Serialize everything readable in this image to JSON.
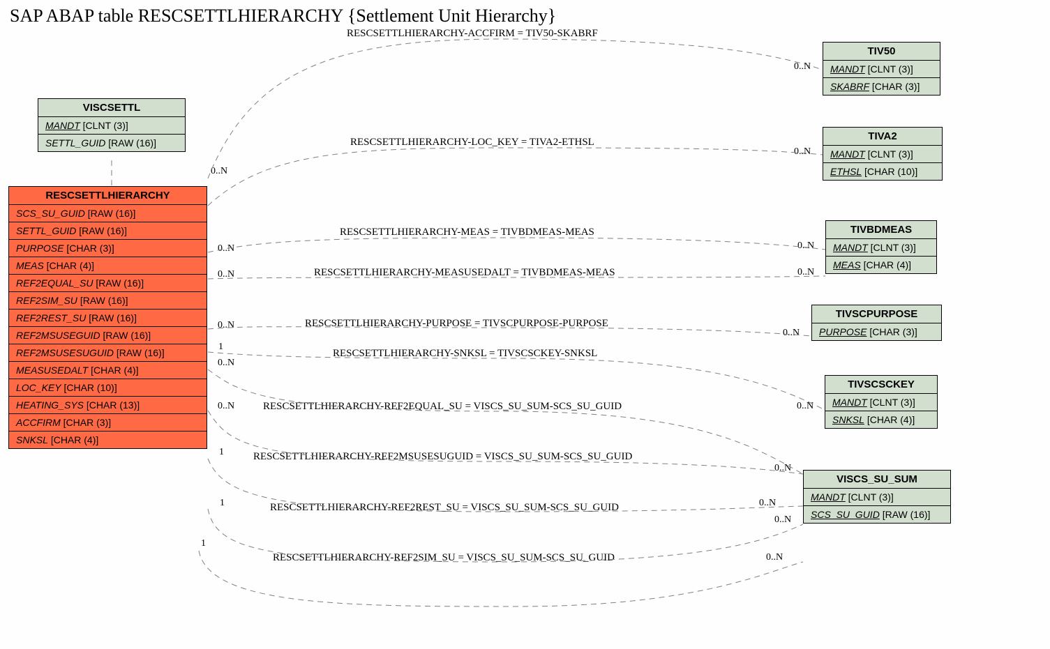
{
  "title": "SAP ABAP table RESCSETTLHIERARCHY {Settlement Unit Hierarchy}",
  "tables": {
    "viscsettl": {
      "name": "VISCSETTL",
      "rows": [
        {
          "name": "MANDT",
          "type": "[CLNT (3)]",
          "underline": true
        },
        {
          "name": "SETTL_GUID",
          "type": "[RAW (16)]",
          "underline": false
        }
      ]
    },
    "main": {
      "name": "RESCSETTLHIERARCHY",
      "rows": [
        {
          "name": "SCS_SU_GUID",
          "type": "[RAW (16)]",
          "underline": false
        },
        {
          "name": "SETTL_GUID",
          "type": "[RAW (16)]",
          "underline": false
        },
        {
          "name": "PURPOSE",
          "type": "[CHAR (3)]",
          "underline": false
        },
        {
          "name": "MEAS",
          "type": "[CHAR (4)]",
          "underline": false
        },
        {
          "name": "REF2EQUAL_SU",
          "type": "[RAW (16)]",
          "underline": false
        },
        {
          "name": "REF2SIM_SU",
          "type": "[RAW (16)]",
          "underline": false
        },
        {
          "name": "REF2REST_SU",
          "type": "[RAW (16)]",
          "underline": false
        },
        {
          "name": "REF2MSUSEGUID",
          "type": "[RAW (16)]",
          "underline": false
        },
        {
          "name": "REF2MSUSESUGUID",
          "type": "[RAW (16)]",
          "underline": false
        },
        {
          "name": "MEASUSEDALT",
          "type": "[CHAR (4)]",
          "underline": false
        },
        {
          "name": "LOC_KEY",
          "type": "[CHAR (10)]",
          "underline": false
        },
        {
          "name": "HEATING_SYS",
          "type": "[CHAR (13)]",
          "underline": false
        },
        {
          "name": "ACCFIRM",
          "type": "[CHAR (3)]",
          "underline": false
        },
        {
          "name": "SNKSL",
          "type": "[CHAR (4)]",
          "underline": false
        }
      ]
    },
    "tiv50": {
      "name": "TIV50",
      "rows": [
        {
          "name": "MANDT",
          "type": "[CLNT (3)]",
          "underline": true
        },
        {
          "name": "SKABRF",
          "type": "[CHAR (3)]",
          "underline": true
        }
      ]
    },
    "tiva2": {
      "name": "TIVA2",
      "rows": [
        {
          "name": "MANDT",
          "type": "[CLNT (3)]",
          "underline": true
        },
        {
          "name": "ETHSL",
          "type": "[CHAR (10)]",
          "underline": true
        }
      ]
    },
    "tivbdmeas": {
      "name": "TIVBDMEAS",
      "rows": [
        {
          "name": "MANDT",
          "type": "[CLNT (3)]",
          "underline": true
        },
        {
          "name": "MEAS",
          "type": "[CHAR (4)]",
          "underline": true
        }
      ]
    },
    "tivscpurpose": {
      "name": "TIVSCPURPOSE",
      "rows": [
        {
          "name": "PURPOSE",
          "type": "[CHAR (3)]",
          "underline": true
        }
      ]
    },
    "tivscsckey": {
      "name": "TIVSCSCKEY",
      "rows": [
        {
          "name": "MANDT",
          "type": "[CLNT (3)]",
          "underline": true
        },
        {
          "name": "SNKSL",
          "type": "[CHAR (4)]",
          "underline": true
        }
      ]
    },
    "viscs_su_sum": {
      "name": "VISCS_SU_SUM",
      "rows": [
        {
          "name": "MANDT",
          "type": "[CLNT (3)]",
          "underline": true
        },
        {
          "name": "SCS_SU_GUID",
          "type": "[RAW (16)]",
          "underline": true
        }
      ]
    }
  },
  "relations": [
    {
      "label": "RESCSETTLHIERARCHY-ACCFIRM = TIV50-SKABRF",
      "leftCard": "0..N",
      "rightCard": "0..N"
    },
    {
      "label": "RESCSETTLHIERARCHY-LOC_KEY = TIVA2-ETHSL",
      "leftCard": "",
      "rightCard": "0..N"
    },
    {
      "label": "RESCSETTLHIERARCHY-MEAS = TIVBDMEAS-MEAS",
      "leftCard": "0..N",
      "rightCard": "0..N"
    },
    {
      "label": "RESCSETTLHIERARCHY-MEASUSEDALT = TIVBDMEAS-MEAS",
      "leftCard": "0..N",
      "rightCard": "0..N"
    },
    {
      "label": "RESCSETTLHIERARCHY-PURPOSE = TIVSCPURPOSE-PURPOSE",
      "leftCard": "0..N",
      "rightCard": "0..N"
    },
    {
      "label": "RESCSETTLHIERARCHY-SNKSL = TIVSCSCKEY-SNKSL",
      "leftCard": "1",
      "rightCard": ""
    },
    {
      "label": "RESCSETTLHIERARCHY-REF2EQUAL_SU = VISCS_SU_SUM-SCS_SU_GUID",
      "leftCard": "0..N",
      "rightCard": "0..N"
    },
    {
      "label": "RESCSETTLHIERARCHY-REF2MSUSESUGUID = VISCS_SU_SUM-SCS_SU_GUID",
      "leftCard": "1",
      "rightCard": "0..N"
    },
    {
      "label": "RESCSETTLHIERARCHY-REF2REST_SU = VISCS_SU_SUM-SCS_SU_GUID",
      "leftCard": "1",
      "rightCard": "0..N"
    },
    {
      "label": "RESCSETTLHIERARCHY-REF2SIM_SU = VISCS_SU_SUM-SCS_SU_GUID",
      "leftCard": "1",
      "rightCard": "0..N"
    }
  ],
  "extraCards": {
    "below_sim": "0..N",
    "viscs_mid": "0..N",
    "tivscsckey_card": "0..N"
  }
}
